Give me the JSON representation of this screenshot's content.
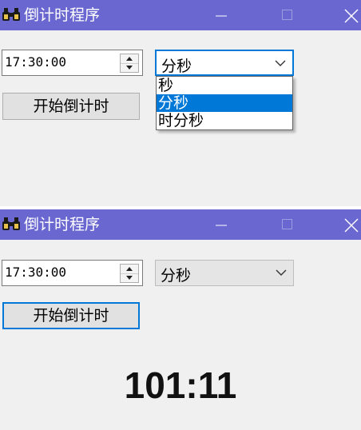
{
  "window": {
    "title": "倒计时程序",
    "icon": "binoculars-icon"
  },
  "screen1": {
    "time_value": "17:30:00",
    "combo_selected": "分秒",
    "dropdown_options": [
      "秒",
      "分秒",
      "时分秒"
    ],
    "dropdown_highlighted": "分秒",
    "start_label": "开始倒计时"
  },
  "screen2": {
    "time_value": "17:30:00",
    "combo_selected": "分秒",
    "start_label": "开始倒计时",
    "countdown": "101:11"
  },
  "colors": {
    "titlebar": "#6a68d0",
    "accent": "#0078d7",
    "window_bg": "#f0f0f0"
  }
}
